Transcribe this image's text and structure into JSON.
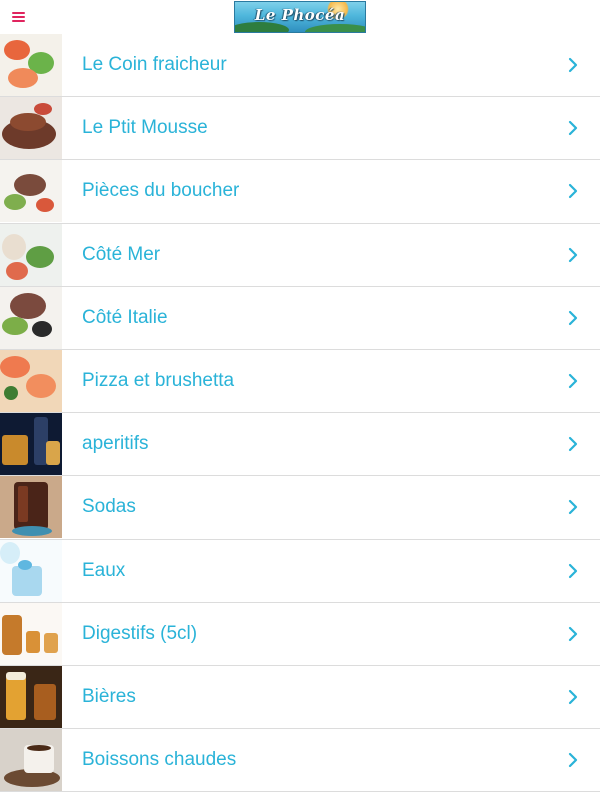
{
  "header": {
    "menu_icon": "hamburger-menu-icon",
    "logo_text": "Le Phocéa",
    "accent_color": "#e0245e"
  },
  "menu": {
    "text_color": "#2ab3d8",
    "chevron_icon": "chevron-right-icon",
    "items": [
      {
        "label": "Le Coin fraicheur",
        "thumb": "salad"
      },
      {
        "label": "Le Ptit Mousse",
        "thumb": "steak"
      },
      {
        "label": "Pièces du boucher",
        "thumb": "meat-plate"
      },
      {
        "label": "Côté Mer",
        "thumb": "seafood"
      },
      {
        "label": "Côté Italie",
        "thumb": "italian-plate"
      },
      {
        "label": "Pizza et brushetta",
        "thumb": "shrimp-pizza"
      },
      {
        "label": "aperitifs",
        "thumb": "spirits"
      },
      {
        "label": "Sodas",
        "thumb": "soda-glass"
      },
      {
        "label": "Eaux",
        "thumb": "water-glass"
      },
      {
        "label": "Digestifs (5cl)",
        "thumb": "digestif-bottle"
      },
      {
        "label": "Bières",
        "thumb": "beer-glass"
      },
      {
        "label": "Boissons chaudes",
        "thumb": "coffee-cup"
      }
    ]
  }
}
